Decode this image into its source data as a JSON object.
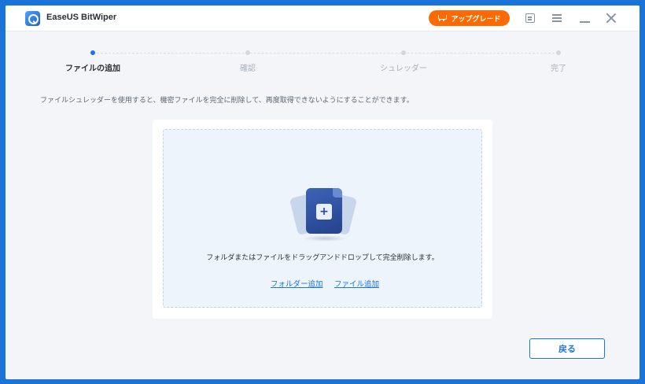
{
  "app": {
    "title": "EaseUS BitWiper"
  },
  "titlebar": {
    "upgrade_label": "アップグレード",
    "upgrade_icon": "cart-icon",
    "icons": [
      "feedback-icon",
      "menu-icon",
      "minimize-icon",
      "close-icon"
    ]
  },
  "steps": [
    {
      "label": "ファイルの追加",
      "active": true
    },
    {
      "label": "確認",
      "active": false
    },
    {
      "label": "シュレッダー",
      "active": false
    },
    {
      "label": "完了",
      "active": false
    }
  ],
  "description": "ファイルシュレッダーを使用すると、機密ファイルを完全に削除して、再度取得できないようにすることができます。",
  "dropzone": {
    "hint": "フォルダまたはファイルをドラッグアンドドロップして完全削除します。",
    "add_folder_label": "フォルダー追加",
    "add_file_label": "ファイル追加"
  },
  "footer": {
    "back_label": "戻る"
  },
  "colors": {
    "accent": "#1a73e8",
    "upgrade": "#ff6a00",
    "frame": "#1a73d8"
  }
}
